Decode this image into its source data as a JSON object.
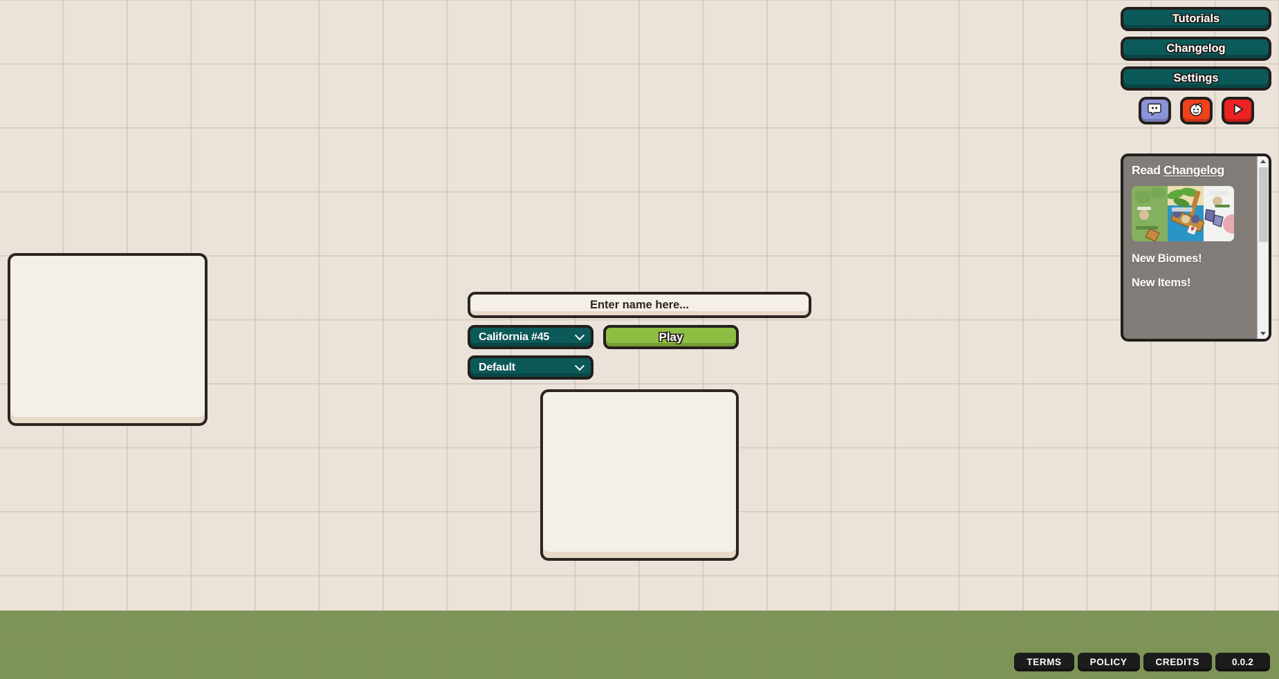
{
  "game": {
    "background_color": "#ebe3da",
    "ground_color": "#7d9456",
    "accent_teal": "#0b5a59",
    "accent_green": "#8fbf42"
  },
  "menu": {
    "tutorials_label": "Tutorials",
    "changelog_label": "Changelog",
    "settings_label": "Settings"
  },
  "social": {
    "discord_label": "discord-icon",
    "reddit_label": "reddit-icon",
    "youtube_label": "youtube-icon"
  },
  "changelog": {
    "title_prefix": "Read ",
    "title_link": "Changelog",
    "items": [
      {
        "label": "New Biomes!"
      },
      {
        "label": "New Items!"
      }
    ]
  },
  "play_form": {
    "name_placeholder": "Enter name here...",
    "name_value": "",
    "region_selected": "California #45",
    "region_options": [
      "California #45"
    ],
    "skin_selected": "Default",
    "skin_options": [
      "Default"
    ],
    "play_label": "Play"
  },
  "footer": {
    "terms_label": "TERMS",
    "policy_label": "POLICY",
    "credits_label": "CREDITS",
    "version_label": "0.0.2"
  }
}
